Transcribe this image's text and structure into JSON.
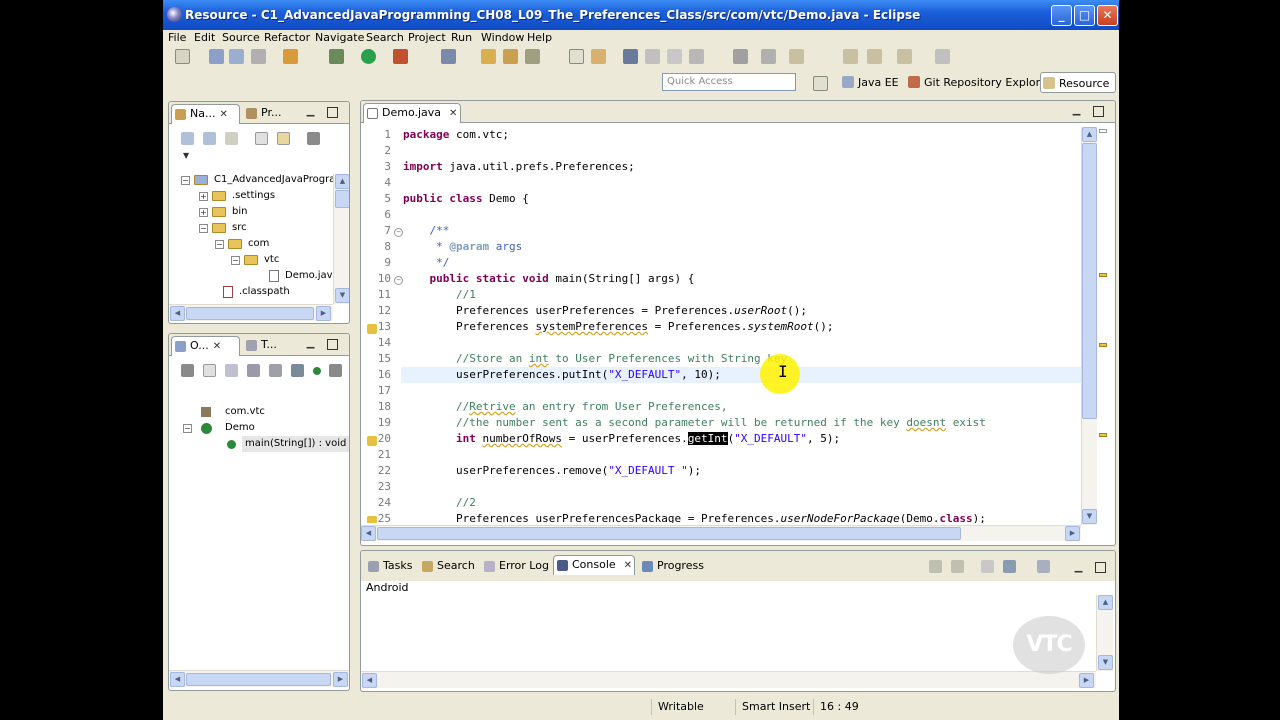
{
  "window": {
    "title": "Resource - C1_AdvancedJavaProgramming_CH08_L09_The_Preferences_Class/src/com/vtc/Demo.java - Eclipse",
    "controls": [
      "_",
      "□",
      "✕"
    ]
  },
  "menu": [
    "File",
    "Edit",
    "Source",
    "Refactor",
    "Navigate",
    "Search",
    "Project",
    "Run",
    "Window",
    "Help"
  ],
  "quick_access": {
    "placeholder": "Quick Access"
  },
  "perspectives": [
    {
      "label": "Java EE",
      "active": false
    },
    {
      "label": "Git Repository Exploring",
      "active": false
    },
    {
      "label": "Resource",
      "active": true
    }
  ],
  "navigator": {
    "tabs": [
      {
        "label": "Na...",
        "close": "✕"
      },
      {
        "label": "Pr...",
        "close": ""
      }
    ],
    "tree": [
      {
        "label": "C1_AdvancedJavaProgra",
        "expander": "−"
      },
      {
        "label": ".settings",
        "expander": "+"
      },
      {
        "label": "bin",
        "expander": "+"
      },
      {
        "label": "src",
        "expander": "−"
      },
      {
        "label": "com",
        "expander": "−"
      },
      {
        "label": "vtc",
        "expander": "−"
      },
      {
        "label": "Demo.java",
        "expander": ""
      },
      {
        "label": ".classpath",
        "expander": ""
      }
    ]
  },
  "outline": {
    "tabs": [
      {
        "label": "O...",
        "close": "✕"
      },
      {
        "label": "T...",
        "close": ""
      }
    ],
    "tree": [
      {
        "label": "com.vtc"
      },
      {
        "label": "Demo"
      },
      {
        "label": "main(String[]) : void"
      }
    ]
  },
  "editor": {
    "tab": {
      "label": "Demo.java",
      "close": "✕"
    },
    "line_numbers": [
      "1",
      "2",
      "3",
      "4",
      "5",
      "6",
      "7",
      "8",
      "9",
      "10",
      "11",
      "12",
      "13",
      "14",
      "15",
      "16",
      "17",
      "18",
      "19",
      "20",
      "21",
      "22",
      "23",
      "24",
      "25"
    ]
  },
  "bottom_panel": {
    "tabs": [
      {
        "label": "Tasks"
      },
      {
        "label": "Search"
      },
      {
        "label": "Error Log"
      },
      {
        "label": "Console",
        "close": "✕"
      },
      {
        "label": "Progress"
      }
    ],
    "console_text": "Android"
  },
  "status": {
    "mode": "Writable",
    "insert": "Smart Insert",
    "position": "16 : 49"
  },
  "watermark": "VTC",
  "colors": {
    "keyword": "#7f0055",
    "comment": "#3f7f5f",
    "javadoc": "#3f5fbf",
    "string": "#2a00ff",
    "titlebar": "#1c5fd8",
    "chrome": "#ece9d8"
  }
}
